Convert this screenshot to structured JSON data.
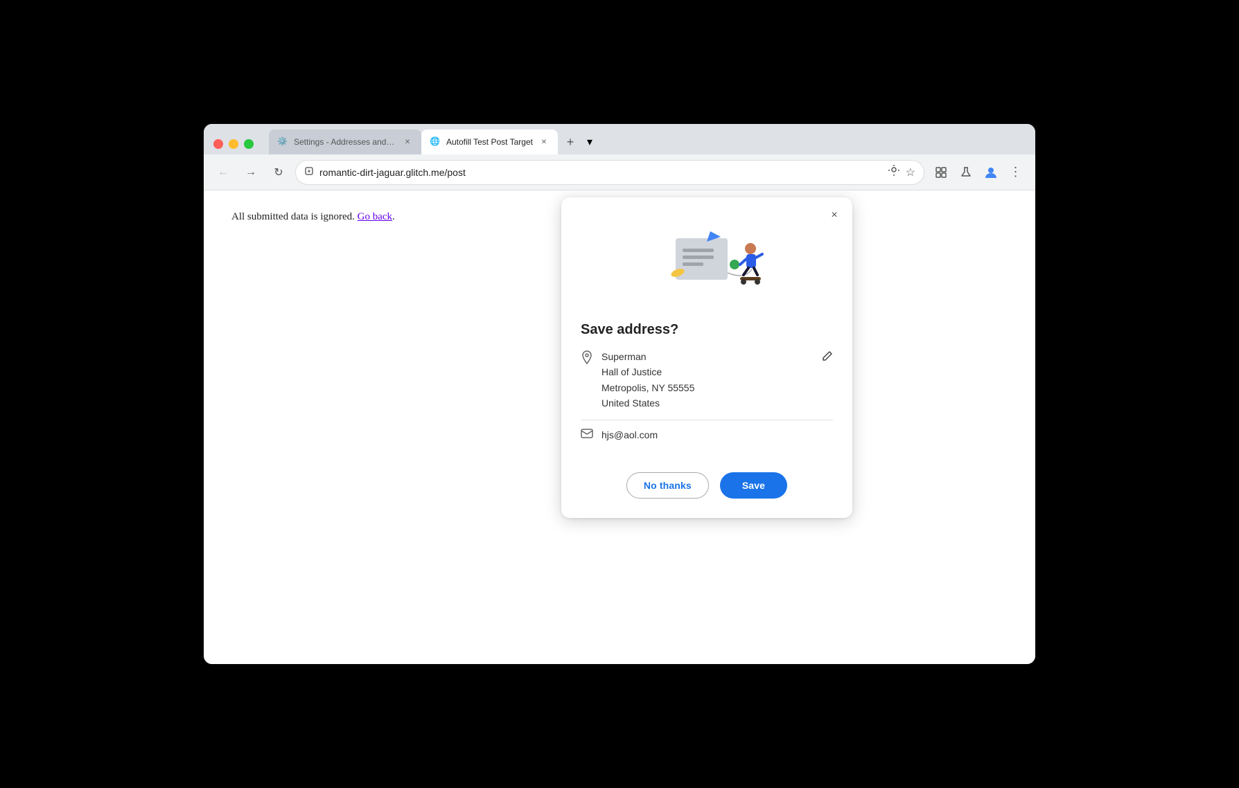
{
  "browser": {
    "tabs": [
      {
        "id": "settings-tab",
        "title": "Settings - Addresses and mo",
        "icon": "⚙",
        "active": false
      },
      {
        "id": "autofill-tab",
        "title": "Autofill Test Post Target",
        "icon": "🌐",
        "active": true
      }
    ],
    "url": "romantic-dirt-jaguar.glitch.me/post",
    "new_tab_label": "+",
    "dropdown_label": "▾"
  },
  "toolbar": {
    "back_label": "←",
    "forward_label": "→",
    "reload_label": "↻"
  },
  "page": {
    "message": "All submitted data is ignored.",
    "go_back_label": "Go back"
  },
  "dialog": {
    "title": "Save address?",
    "close_label": "×",
    "address": {
      "name": "Superman",
      "line1": "Hall of Justice",
      "line2": "Metropolis, NY 55555",
      "line3": "United States"
    },
    "email": "hjs@aol.com",
    "no_thanks_label": "No thanks",
    "save_label": "Save"
  }
}
